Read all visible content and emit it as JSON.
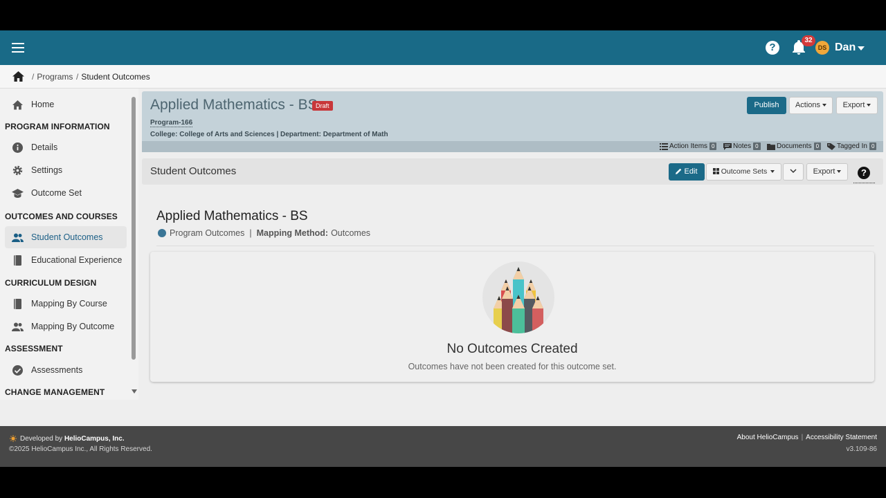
{
  "header": {
    "notification_count": "32",
    "avatar_initials": "DS",
    "user_name": "Dan"
  },
  "breadcrumb": {
    "sep": "/",
    "items": [
      "Programs",
      "Student Outcomes"
    ]
  },
  "sidebar": {
    "home": "Home",
    "sections": [
      {
        "heading": "PROGRAM INFORMATION",
        "items": [
          "Details",
          "Settings",
          "Outcome Set"
        ]
      },
      {
        "heading": "OUTCOMES AND COURSES",
        "items": [
          "Student Outcomes",
          "Educational Experience"
        ]
      },
      {
        "heading": "CURRICULUM DESIGN",
        "items": [
          "Mapping By Course",
          "Mapping By Outcome"
        ]
      },
      {
        "heading": "ASSESSMENT",
        "items": [
          "Assessments"
        ]
      },
      {
        "heading": "CHANGE MANAGEMENT",
        "items": []
      }
    ],
    "active_item": "Student Outcomes"
  },
  "program": {
    "title": "Applied Mathematics - BS",
    "status_badge": "Draft",
    "code": "Program-166",
    "meta": "College: College of Arts and Sciences | Department: Department of Math",
    "publish_label": "Publish",
    "actions_label": "Actions",
    "export_label": "Export",
    "strip": {
      "action_items_label": "Action Items",
      "action_items_count": "0",
      "notes_label": "Notes",
      "notes_count": "0",
      "documents_label": "Documents",
      "documents_count": "0",
      "tagged_label": "Tagged In",
      "tagged_count": "0"
    }
  },
  "outcomes_bar": {
    "title": "Student Outcomes",
    "edit_label": "Edit",
    "outcome_sets_label": "Outcome Sets",
    "export_label": "Export",
    "help": "?"
  },
  "main": {
    "title": "Applied Mathematics - BS",
    "outcome_type": "Program Outcomes",
    "divider": "|",
    "mapping_label": "Mapping Method:",
    "mapping_value": "Outcomes",
    "empty_title": "No Outcomes Created",
    "empty_text": "Outcomes have not been created for this outcome set."
  },
  "footer": {
    "developed_prefix": "Developed by",
    "developer": "HelioCampus, Inc.",
    "copyright": "©2025 HelioCampus Inc., All Rights Reserved.",
    "about_link": "About HelioCampus",
    "link_sep": "|",
    "accessibility_link": "Accessibility Statement",
    "version": "v3.109-86"
  },
  "colors": {
    "topnav": "#196a87",
    "primary_button": "#1b6a88",
    "draft_badge": "#c8373a",
    "program_card": "#c4d2d9"
  }
}
